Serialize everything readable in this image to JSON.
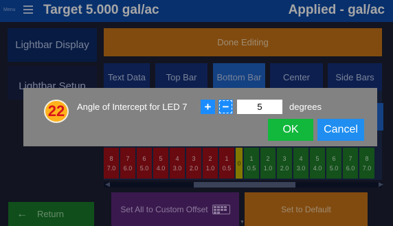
{
  "header": {
    "menu_label": "Menu",
    "target": "Target 5.000 gal/ac",
    "applied": "Applied - gal/ac"
  },
  "sidebar": {
    "lightbar_display": "Lightbar Display",
    "lightbar_setup": "Lightbar Setup"
  },
  "editor": {
    "done_editing": "Done Editing",
    "tabs": [
      {
        "label": "Text Data"
      },
      {
        "label": "Top Bar"
      },
      {
        "label": "Bottom Bar"
      },
      {
        "label": "Center"
      },
      {
        "label": "Side Bars"
      }
    ],
    "leds": [
      {
        "num": "8",
        "val": "7.0",
        "color": "red"
      },
      {
        "num": "7",
        "val": "6.0",
        "color": "red"
      },
      {
        "num": "6",
        "val": "5.0",
        "color": "red"
      },
      {
        "num": "5",
        "val": "4.0",
        "color": "red"
      },
      {
        "num": "4",
        "val": "3.0",
        "color": "red"
      },
      {
        "num": "3",
        "val": "2.0",
        "color": "red"
      },
      {
        "num": "2",
        "val": "1.0",
        "color": "red"
      },
      {
        "num": "1",
        "val": "0.5",
        "color": "red"
      },
      {
        "num": "0",
        "val": "",
        "color": "yellow"
      },
      {
        "num": "1",
        "val": "0.5",
        "color": "green"
      },
      {
        "num": "2",
        "val": "1.0",
        "color": "green"
      },
      {
        "num": "3",
        "val": "2.0",
        "color": "green"
      },
      {
        "num": "4",
        "val": "3.0",
        "color": "green"
      },
      {
        "num": "5",
        "val": "4.0",
        "color": "green"
      },
      {
        "num": "6",
        "val": "5.0",
        "color": "green"
      },
      {
        "num": "7",
        "val": "6.0",
        "color": "green"
      },
      {
        "num": "8",
        "val": "7.0",
        "color": "green"
      }
    ],
    "scroll_left_icon": "chevron-left-icon",
    "scroll_right_icon": "chevron-right-icon"
  },
  "footer": {
    "return_label": "Return",
    "custom_offset_label": "Set All to Custom Offset",
    "set_default_label": "Set to Default"
  },
  "dialog": {
    "step_number": "22",
    "prompt": "Angle of Intercept for LED 7",
    "plus": "+",
    "minus": "−",
    "value": "5",
    "units": "degrees",
    "ok": "OK",
    "cancel": "Cancel"
  },
  "colors": {
    "header_blue": "#0d4aa8",
    "accent_orange": "#c6731a",
    "ok_green": "#11b83c",
    "cancel_blue": "#1f8ef0",
    "badge_yellow": "#ffb21c",
    "badge_red": "#d8141a"
  }
}
